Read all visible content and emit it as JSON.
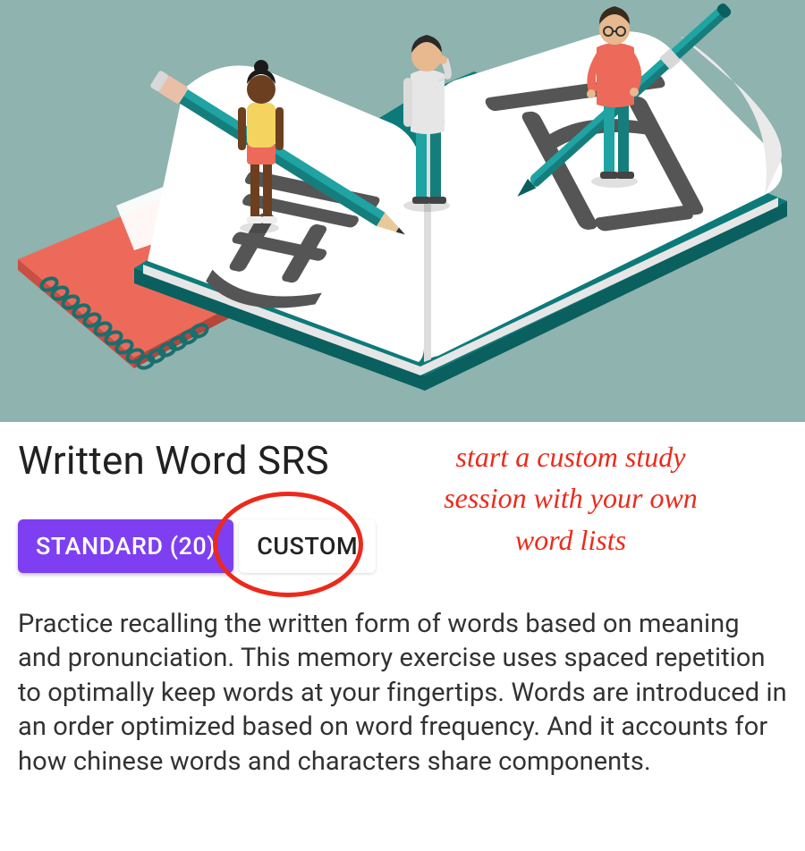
{
  "title": "Written Word SRS",
  "buttons": {
    "standard": "STANDARD (20)",
    "custom": "CUSTOM"
  },
  "description": "Practice recalling the written form of words based on meaning and pronunciation. This memory exercise uses spaced repetition to optimally keep words at your fingertips. Words are introduced in an order optimized based on word frequency. And it accounts for how chinese words and characters share components.",
  "annotation": {
    "line1": "start a custom study",
    "line2": "session with your own",
    "line3": "word lists"
  }
}
